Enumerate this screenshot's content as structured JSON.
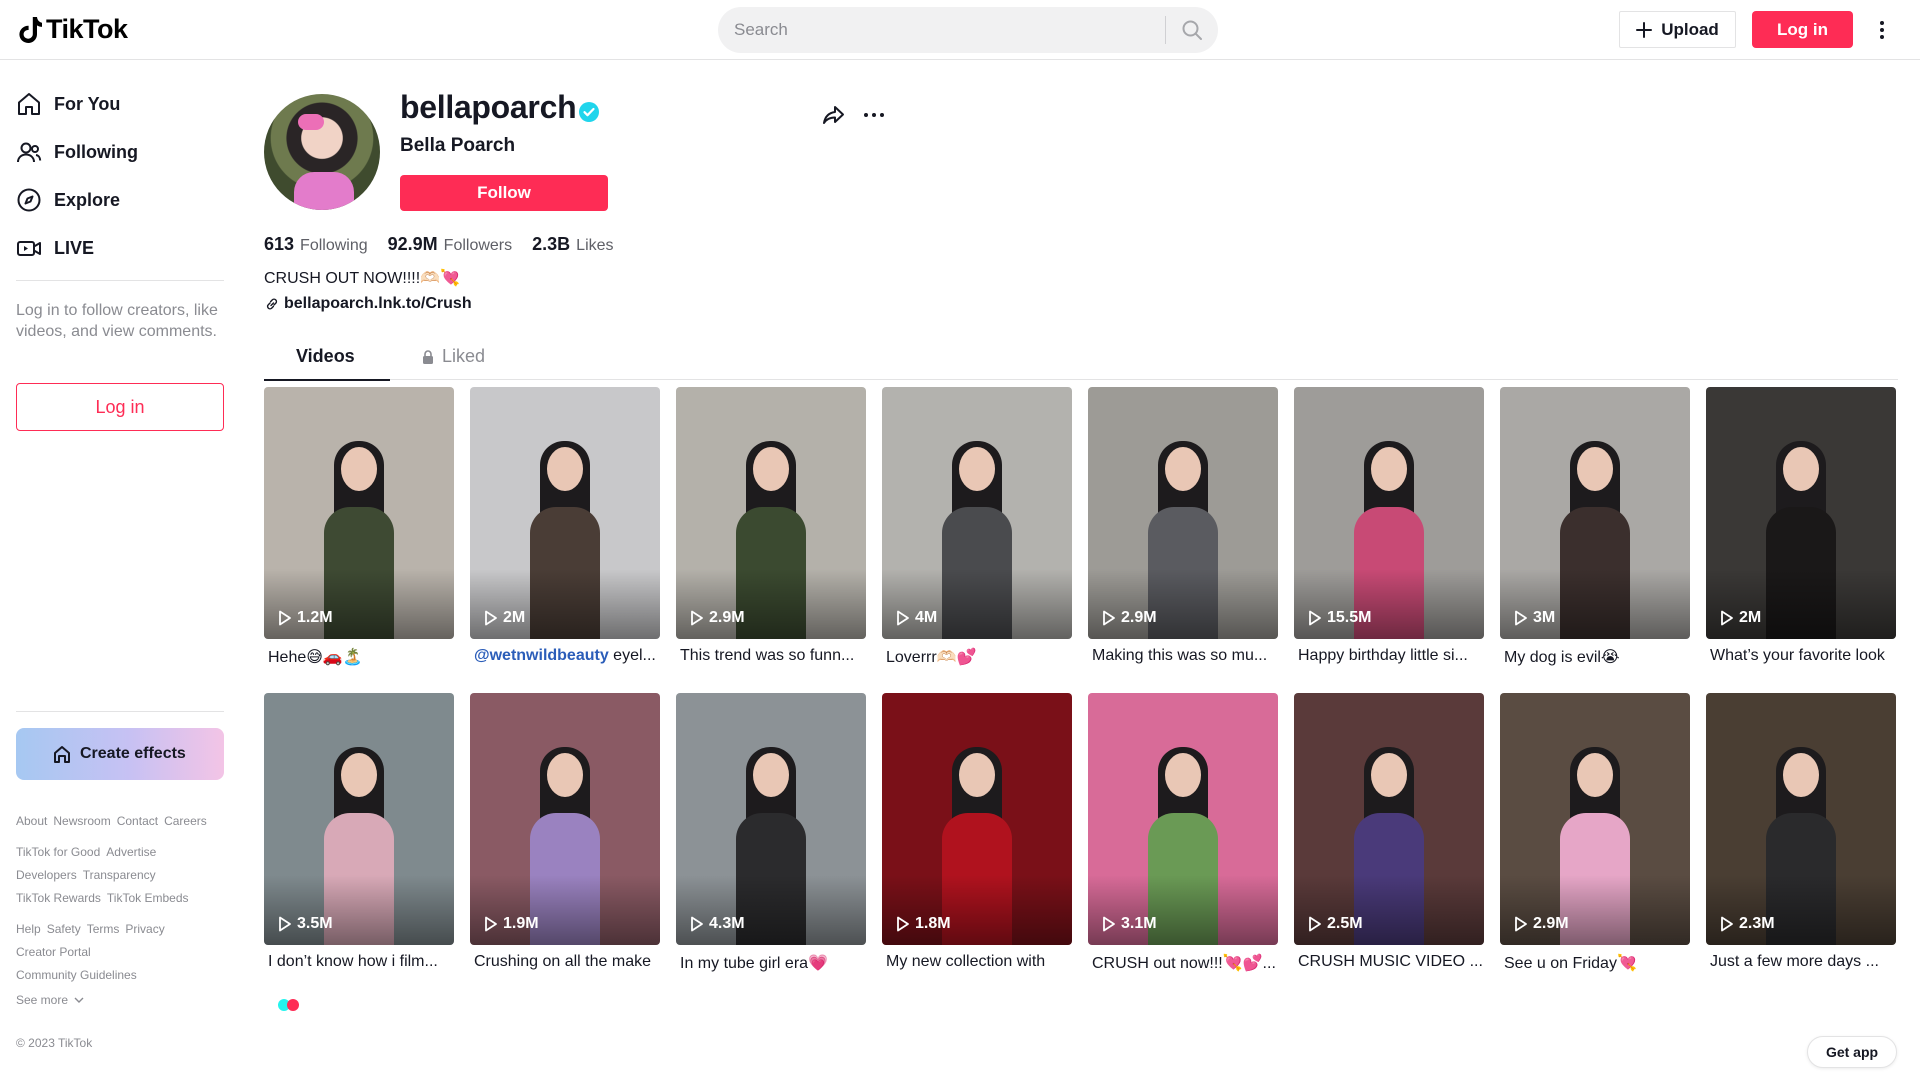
{
  "header": {
    "logo_text": "TikTok",
    "search_placeholder": "Search",
    "upload_label": "Upload",
    "login_label": "Log in"
  },
  "sidebar": {
    "nav": [
      {
        "label": "For You",
        "icon": "home-icon"
      },
      {
        "label": "Following",
        "icon": "following-icon"
      },
      {
        "label": "Explore",
        "icon": "compass-icon"
      },
      {
        "label": "LIVE",
        "icon": "live-icon"
      }
    ],
    "login_prompt": "Log in to follow creators, like videos, and view comments.",
    "login_button": "Log in",
    "create_effects": "Create effects",
    "footer_rows": [
      [
        "About",
        "Newsroom",
        "Contact",
        "Careers"
      ],
      [
        "TikTok for Good",
        "Advertise"
      ],
      [
        "Developers",
        "Transparency"
      ],
      [
        "TikTok Rewards",
        "TikTok Embeds"
      ],
      [
        "Help",
        "Safety",
        "Terms",
        "Privacy"
      ],
      [
        "Creator Portal"
      ],
      [
        "Community Guidelines"
      ]
    ],
    "see_more": "See more",
    "copyright": "© 2023 TikTok"
  },
  "profile": {
    "username": "bellapoarch",
    "display_name": "Bella Poarch",
    "follow_label": "Follow",
    "stats": [
      {
        "value": "613",
        "label": "Following"
      },
      {
        "value": "92.9M",
        "label": "Followers"
      },
      {
        "value": "2.3B",
        "label": "Likes"
      }
    ],
    "bio": "CRUSH OUT NOW!!!!🫶🏻💘",
    "link": "bellapoarch.lnk.to/Crush"
  },
  "tabs": {
    "videos": "Videos",
    "liked": "Liked"
  },
  "videos": [
    {
      "views": "1.2M",
      "caption": "Hehe😅🚗🏝️",
      "bg": "#b9b3ab",
      "body": "#3e4a33"
    },
    {
      "views": "2M",
      "mention": "@wetnwildbeauty",
      "caption": " eyel...",
      "bg": "#c8c8ca",
      "body": "#4a3d36"
    },
    {
      "views": "2.9M",
      "caption": "This trend was so funn...",
      "bg": "#b4b1aa",
      "body": "#3b4a30"
    },
    {
      "views": "4M",
      "caption": "Loverrr🫶🏻💕",
      "bg": "#b3b2ae",
      "body": "#4a4b4e"
    },
    {
      "views": "2.9M",
      "caption": "Making this was so mu...",
      "bg": "#9d9b96",
      "body": "#5a5b60"
    },
    {
      "views": "15.5M",
      "caption": "Happy birthday little si...",
      "bg": "#9e9c99",
      "body": "#c84a75"
    },
    {
      "views": "3M",
      "caption": "My dog is evil😭",
      "bg": "#aaa8a5",
      "body": "#3b2f2d"
    },
    {
      "views": "2M",
      "caption": "What’s your favorite look",
      "bg": "#3a3836",
      "body": "#1a1818"
    },
    {
      "views": "3.5M",
      "caption": "I don’t know how i film...",
      "bg": "#7f8a8e",
      "body": "#d8a9b7"
    },
    {
      "views": "1.9M",
      "caption": "Crushing on all the make",
      "bg": "#8a5a64",
      "body": "#9a82c0"
    },
    {
      "views": "4.3M",
      "caption": "In my tube girl era💗",
      "bg": "#8c9296",
      "body": "#2b2b2d"
    },
    {
      "views": "1.8M",
      "caption": "My new collection with",
      "bg": "#7a1018",
      "body": "#b0121e"
    },
    {
      "views": "3.1M",
      "caption": "CRUSH out now!!!💘💕...",
      "bg": "#d86b98",
      "body": "#6a9a55"
    },
    {
      "views": "2.5M",
      "caption": "CRUSH MUSIC VIDEO ...",
      "bg": "#5a3a3a",
      "body": "#4a3a7a"
    },
    {
      "views": "2.9M",
      "caption": "See u on Friday💘",
      "bg": "#5a4c42",
      "body": "#e6a6c7"
    },
    {
      "views": "2.3M",
      "caption": "Just a few more days ...",
      "bg": "#4a3e33",
      "body": "#2a2a2c"
    }
  ],
  "get_app": "Get app",
  "colors": {
    "brand": "#fe2c55",
    "verified": "#20d5ec",
    "text_secondary": "#8a8b91"
  }
}
